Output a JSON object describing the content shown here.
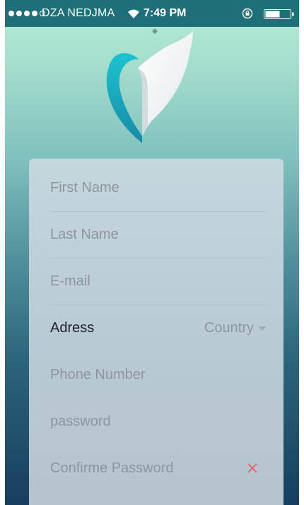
{
  "status_bar": {
    "carrier": "DZA NEDJMA",
    "time": "7:49 PM",
    "signal_icon": "signal-dots-icon",
    "wifi_icon": "wifi-icon",
    "lock_icon": "orientation-lock-icon",
    "battery_icon": "battery-icon"
  },
  "logo_icon": "heart-d-logo-icon",
  "form": {
    "first_name_placeholder": "First Name",
    "last_name_placeholder": "Last Name",
    "email_placeholder": "E-mail",
    "address_label": "Adress",
    "country_label": "Country",
    "phone_placeholder": "Phone Number",
    "password_placeholder": "password",
    "confirm_password_placeholder": "Confirme Password",
    "clear_icon": "close-icon"
  },
  "colors": {
    "status_bar": "#1f6f79",
    "gradient_top": "#b5eed6",
    "gradient_bottom": "#173f5d",
    "card": "#d0dae2",
    "placeholder": "#8e969d",
    "label": "#1d2228",
    "clear_icon": "#ef5a5a",
    "logo_teal": "#1bb3c9"
  }
}
